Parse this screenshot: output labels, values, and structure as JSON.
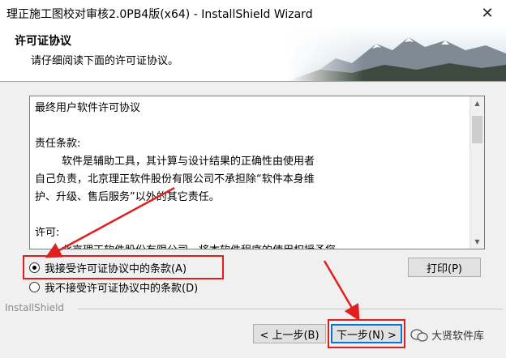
{
  "window": {
    "title": "理正施工图校对审核2.0PB4版(x64) - InstallShield Wizard",
    "close": "✕"
  },
  "header": {
    "title": "许可证协议",
    "subtitle": "请仔细阅读下面的许可证协议。"
  },
  "license_text": "最终用户软件许可协议\n\n责任条款:\n        软件是辅助工具，其计算与设计结果的正确性由使用者\n自己负责，北京理正软件股份有限公司不承担除“软件本身维\n护、升级、售后服务”以外的其它责任。\n\n许可:\n        北京理正软件股份有限公司，将本软件程序的使用权授予您。\n    …… (部分文本被遮挡) ……",
  "radios": {
    "accept": "我接受许可证协议中的条款(A)",
    "decline": "我不接受许可证协议中的条款(D)",
    "selected": "accept"
  },
  "buttons": {
    "print": "打印(P)",
    "back": "< 上一步(B)",
    "next": "下一步(N) >"
  },
  "footer": {
    "brand": "InstallShield"
  },
  "watermark": {
    "text": "大贤软件库"
  },
  "colors": {
    "highlight": "#e0201e",
    "primary_border": "#0078d7"
  }
}
